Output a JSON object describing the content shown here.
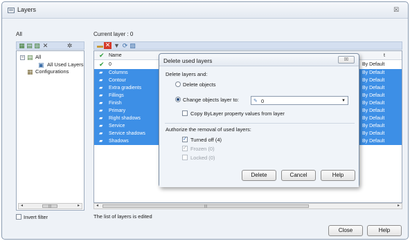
{
  "window": {
    "title": "Layers",
    "close_glyph": "☒"
  },
  "left_panel": {
    "label": "All",
    "tree": [
      {
        "label": "All",
        "expanded": true
      },
      {
        "label": "All Used Layers"
      },
      {
        "label": "Configurations"
      }
    ],
    "invert_filter": {
      "label": "Invert filter",
      "checked": false
    }
  },
  "right_panel": {
    "current_layer_label": "Current layer : 0",
    "column_name_header": "Name",
    "column_partial_header": "t",
    "rows": [
      {
        "name": "0",
        "value": "By Default",
        "selected": false,
        "current": true
      },
      {
        "name": "Columns",
        "value": "By Default",
        "selected": true
      },
      {
        "name": "Contour",
        "value": "By Default",
        "selected": true
      },
      {
        "name": "Extra gradients",
        "value": "By Default",
        "selected": true
      },
      {
        "name": "Fillings",
        "value": "By Default",
        "selected": true
      },
      {
        "name": "Finish",
        "value": "By Default",
        "selected": true
      },
      {
        "name": "Primary",
        "value": "By Default",
        "selected": true
      },
      {
        "name": "Right shadows",
        "value": "By Default",
        "selected": true
      },
      {
        "name": "Service",
        "value": "By Default",
        "selected": true
      },
      {
        "name": "Service shadows",
        "value": "By Default",
        "selected": true
      },
      {
        "name": "Shadows",
        "value": "By Default",
        "selected": true
      }
    ],
    "status_text": "The list of layers is edited"
  },
  "buttons": {
    "close": "Close",
    "help": "Help"
  },
  "dialog": {
    "title": "Delete used layers",
    "close_glyph": "☒",
    "delete_group_label": "Delete layers and:",
    "option_delete_objects": "Delete objects",
    "option_change_layer": "Change objects layer to:",
    "selected_option": "change_layer",
    "target_layer_value": "0",
    "copy_bylayer_label": "Copy ByLayer property values from layer",
    "copy_bylayer_checked": false,
    "authorize_label": "Authorize the removal of used layers:",
    "turned_off_label": "Turned off (4)",
    "turned_off_checked": true,
    "frozen_label": "Frozen (0)",
    "frozen_checked": true,
    "locked_label": "Locked (0)",
    "locked_checked": false,
    "btn_delete": "Delete",
    "btn_cancel": "Cancel",
    "btn_help": "Help"
  },
  "colors": {
    "selection": "#3d8fe6",
    "toolbar": "#d4dff0",
    "check_green": "#2e9b3a",
    "delete_red": "#d63a2a"
  }
}
